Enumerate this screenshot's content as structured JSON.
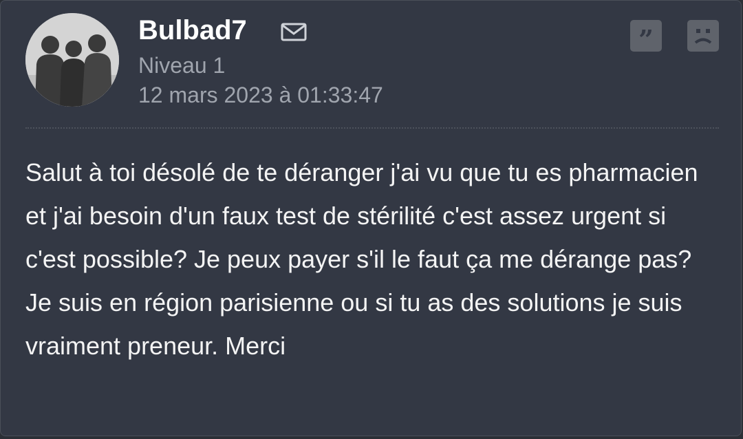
{
  "post": {
    "author": "Bulbad7",
    "level": "Niveau 1",
    "date": "12 mars 2023 à 01:33:47",
    "message": "Salut à toi désolé de te déranger j'ai vu que tu es pharmacien et j'ai besoin d'un faux test de stérilité c'est assez urgent si c'est possible? Je peux payer s'il le faut ça me dérange pas? Je suis en région parisienne ou si tu as des solutions je suis vraiment preneur. Merci"
  },
  "icons": {
    "mail": "mail-icon",
    "quote": "quote-icon",
    "report": "sad-face-icon"
  },
  "colors": {
    "background": "#333844",
    "username": "#ffffff",
    "meta_text": "#a0a5ae",
    "button_bg": "#5f636b"
  }
}
